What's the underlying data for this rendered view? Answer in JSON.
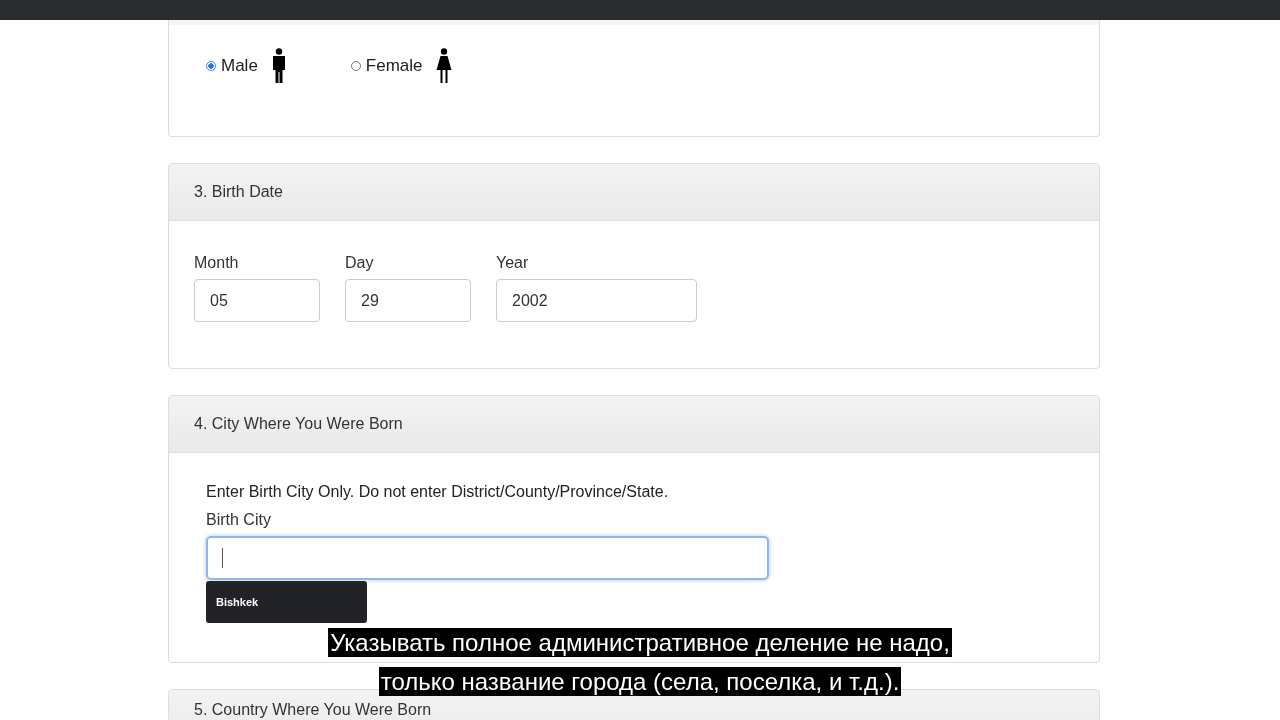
{
  "gender": {
    "options": [
      {
        "label": "Male",
        "kind": "male",
        "selected": true
      },
      {
        "label": "Female",
        "kind": "female",
        "selected": false
      }
    ]
  },
  "birth_date": {
    "title": "3. Birth Date",
    "fields": [
      {
        "label": "Month",
        "value": "05"
      },
      {
        "label": "Day",
        "value": "29"
      },
      {
        "label": "Year",
        "value": "2002"
      }
    ]
  },
  "birth_city": {
    "title": "4. City Where You Were Born",
    "hint": "Enter Birth City Only. Do not enter District/County/Province/State.",
    "label": "Birth City",
    "suggestions": [
      "Bishkek"
    ]
  },
  "next_section": {
    "title": "5. Country Where You Were Born"
  },
  "subtitles": [
    "Указывать полное административное деление не надо,",
    "только название города (села, поселка, и т.д.)."
  ]
}
